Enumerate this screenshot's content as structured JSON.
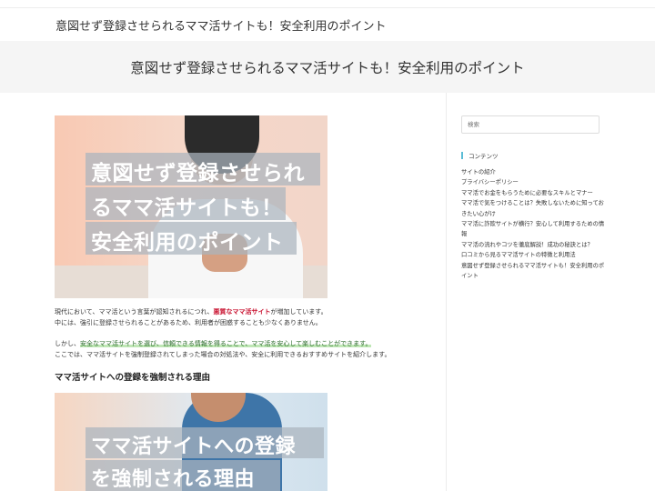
{
  "site": {
    "title": "意図せず登録させられるママ活サイトも！安全利用のポイント"
  },
  "page": {
    "title": "意図せず登録させられるママ活サイトも！安全利用のポイント"
  },
  "article": {
    "hero_image": {
      "lines": [
        "意図せず登録させられ",
        "るママ活サイトも！",
        "安全利用のポイント"
      ]
    },
    "p1": {
      "line1_before": "現代において、ママ活という言葉が認知されるにつれ、",
      "line1_strong": "悪質なママ活サイト",
      "line1_after": "が増加しています。",
      "line2": "中には、強引に登録させられることがあるため、利用者が困惑することも少なくありません。"
    },
    "p2": {
      "line1_prefix": "しかし、",
      "line1_highlight": "安全なママ活サイトを選び、信頼できる情報を得ることで、ママ活を安心して楽しむことができます。",
      "line2": "ここでは、ママ活サイトを強制登録されてしまった場合の対処法や、安全に利用できるおすすめサイトを紹介します。"
    },
    "h2": "ママ活サイトへの登録を強制される理由",
    "second_image": {
      "lines": [
        "ママ活サイトへの登録",
        "を強制される理由"
      ]
    }
  },
  "sidebar": {
    "search_placeholder": "検索",
    "widget_title": "コンテンツ",
    "toc": [
      "サイトの紹介",
      "プライバシーポリシー",
      "ママ活でお金をもらうために必要なスキルとマナー",
      "ママ活で気をつけることは？失敗しないために知っておきたい心がけ",
      "ママ活に詐欺サイトが横行？安心して利用するための情報",
      "ママ活の流れやコツを徹底解説！成功の秘訣とは？",
      "口コミから見るママ活サイトの特徴と利用法",
      "意図せず登録させられるママ活サイトも！安全利用のポイント"
    ]
  },
  "colors": {
    "accent_red": "#c8102e",
    "highlight_green": "#bfe7b5",
    "widget_bar": "#5bbcd6"
  }
}
